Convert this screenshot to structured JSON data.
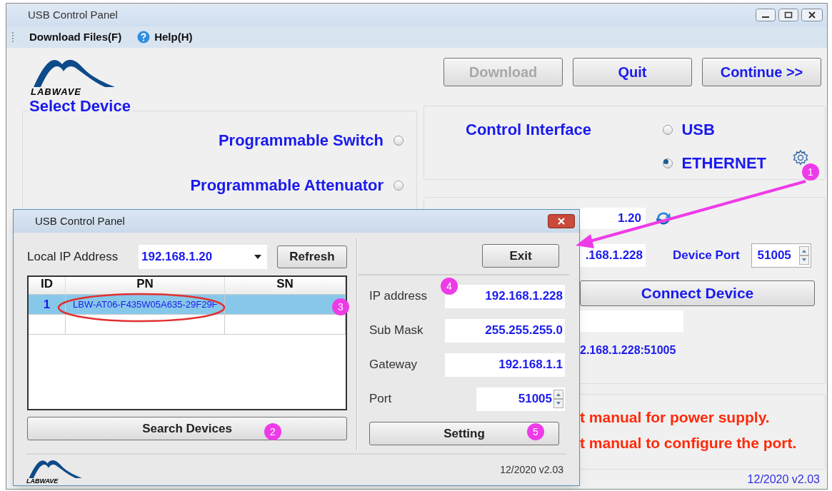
{
  "window": {
    "title": "USB Control Panel"
  },
  "menu": [
    {
      "label": "Download Files(F)",
      "kind": "plain"
    },
    {
      "label": "Help(H)",
      "kind": "help"
    }
  ],
  "logo_text": "LABWAVE",
  "top_buttons": [
    {
      "label": "Download",
      "disabled": true
    },
    {
      "label": "Quit",
      "disabled": false
    },
    {
      "label": "Continue >>",
      "disabled": false
    }
  ],
  "select_device": {
    "title": "Select Device",
    "options": [
      {
        "label": "Programmable Switch",
        "selected": false
      },
      {
        "label": "Programmable Attenuator",
        "selected": false
      }
    ]
  },
  "control_interface": {
    "title": "Control Interface",
    "options": [
      {
        "label": "USB",
        "selected": false
      },
      {
        "label": "ETHERNET",
        "selected": true
      }
    ]
  },
  "connection": {
    "local_ip": "1.20",
    "device_ip": ".168.1.228",
    "device_port_label": "Device Port",
    "device_port": "51005",
    "connect_button": "Connect Device",
    "status": "2.168.1.228:51005"
  },
  "notes": [
    "t manual for power supply.",
    "t manual to configure the port."
  ],
  "version": "12/2020 v2.03",
  "dialog": {
    "title": "USB Control Panel",
    "local_ip_label": "Local IP Address",
    "local_ip": "192.168.1.20",
    "refresh_button": "Refresh",
    "table": {
      "columns": [
        "ID",
        "PN",
        "SN"
      ],
      "rows": [
        {
          "cells": [
            "1",
            "LBW-AT06-F435W05A635-29F29F",
            ""
          ],
          "selected": true
        },
        {
          "cells": [
            "",
            "",
            ""
          ],
          "selected": false
        }
      ]
    },
    "search_button": "Search Devices",
    "exit_button": "Exit",
    "fields": [
      {
        "label": "IP address",
        "value": "192.168.1.228",
        "kind": "text"
      },
      {
        "label": "Sub Mask",
        "value": "255.255.255.0",
        "kind": "text"
      },
      {
        "label": "Gateway",
        "value": "192.168.1.1",
        "kind": "text"
      },
      {
        "label": "Port",
        "value": "51005",
        "kind": "spin"
      }
    ],
    "setting_button": "Setting",
    "logo_text": "LABWAVE",
    "version": "12/2020 v2.03"
  },
  "badges": [
    "1",
    "2",
    "3",
    "4",
    "5"
  ]
}
